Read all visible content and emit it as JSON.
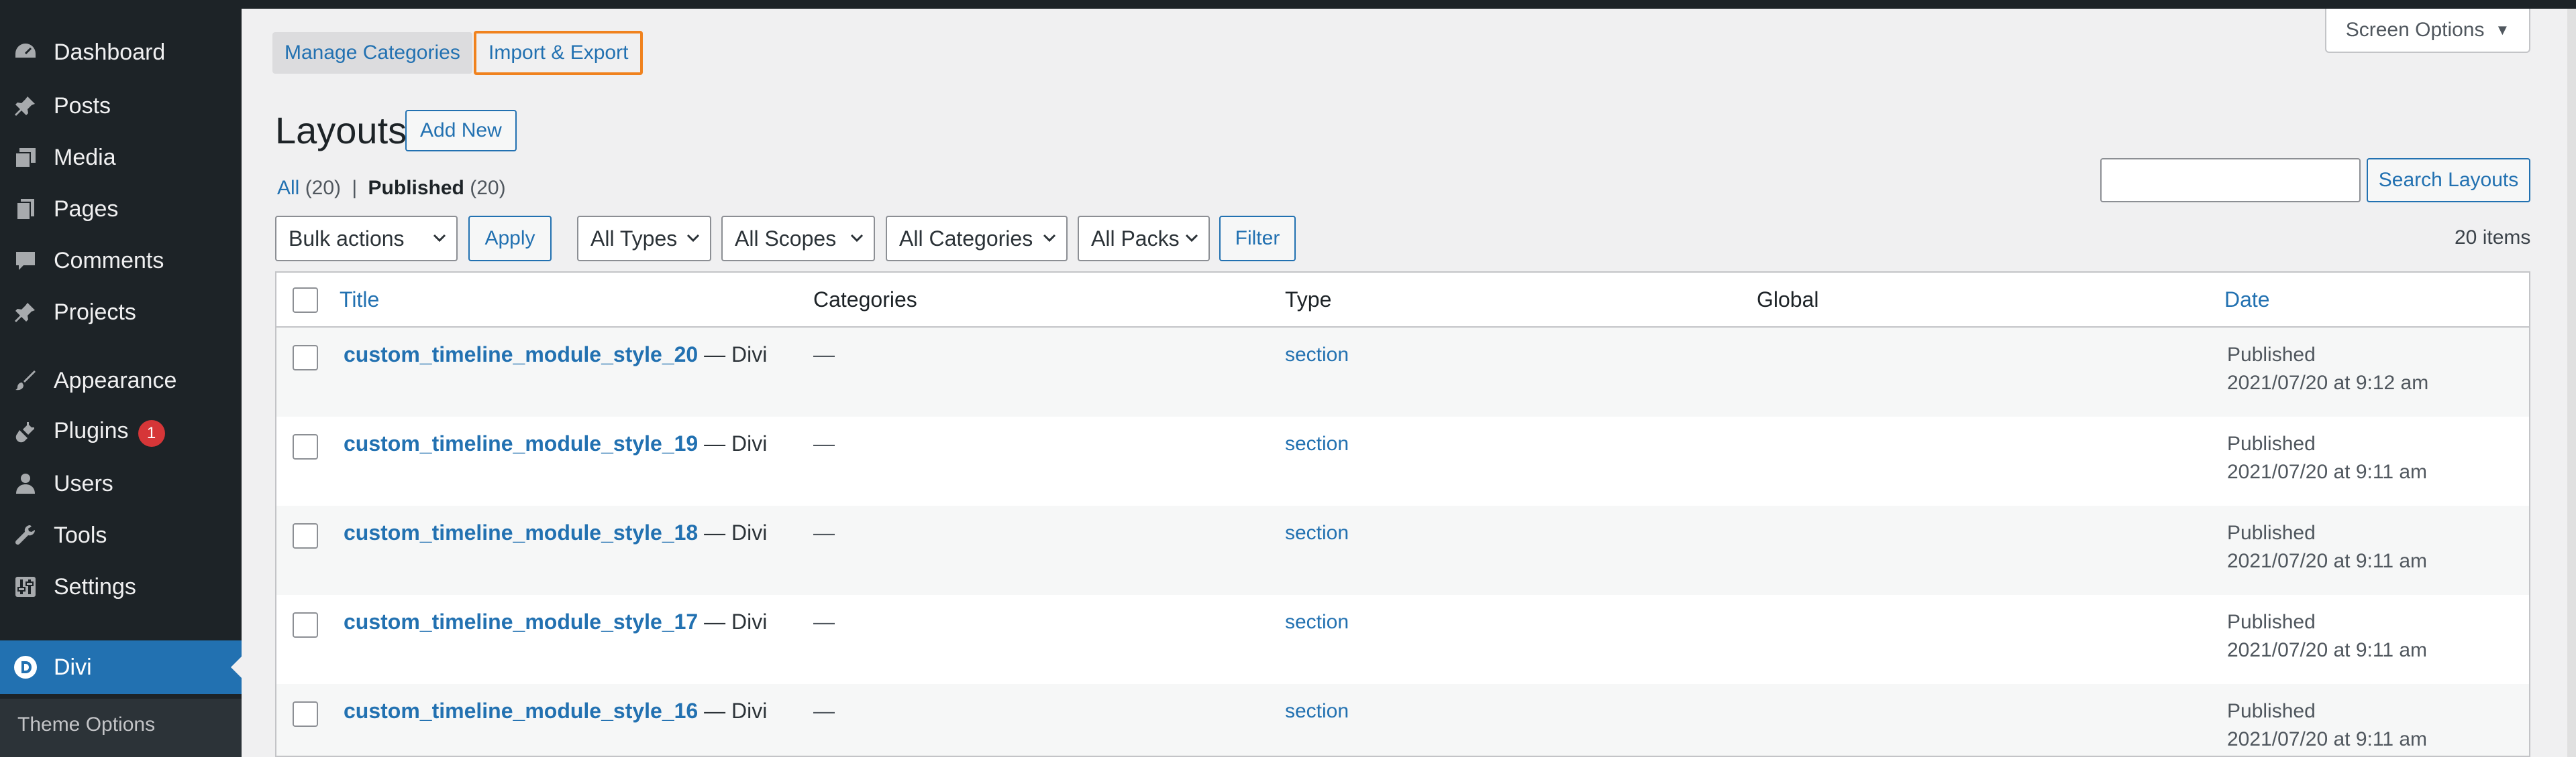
{
  "sidebar": {
    "items": [
      {
        "label": "Dashboard",
        "icon": "dashboard-icon"
      },
      {
        "label": "Posts",
        "icon": "pin-icon"
      },
      {
        "label": "Media",
        "icon": "media-icon"
      },
      {
        "label": "Pages",
        "icon": "pages-icon"
      },
      {
        "label": "Comments",
        "icon": "comment-icon"
      },
      {
        "label": "Projects",
        "icon": "pin-icon"
      },
      {
        "label": "Appearance",
        "icon": "brush-icon"
      },
      {
        "label": "Plugins",
        "icon": "plug-icon",
        "badge": "1"
      },
      {
        "label": "Users",
        "icon": "user-icon"
      },
      {
        "label": "Tools",
        "icon": "wrench-icon"
      },
      {
        "label": "Settings",
        "icon": "settings-icon"
      },
      {
        "label": "Divi",
        "icon": "divi-icon"
      }
    ],
    "submenu_item": "Theme Options"
  },
  "tabs": {
    "manage": "Manage Categories",
    "import_export": "Import & Export"
  },
  "screen_options": "Screen Options",
  "page": {
    "title": "Layouts",
    "add_new": "Add New"
  },
  "filters": {
    "all_label": "All",
    "all_count": "(20)",
    "published_label": "Published",
    "published_count": "(20)",
    "separator": "|"
  },
  "search": {
    "value": "",
    "button": "Search Layouts"
  },
  "toolbar": {
    "bulk": "Bulk actions",
    "apply": "Apply",
    "types": "All Types",
    "scopes": "All Scopes",
    "categories": "All Categories",
    "packs": "All Packs",
    "filter": "Filter",
    "items_count": "20 items"
  },
  "table": {
    "columns": {
      "title": "Title",
      "categories": "Categories",
      "type": "Type",
      "global": "Global",
      "date": "Date"
    },
    "rows": [
      {
        "title": "custom_timeline_module_style_20",
        "suffix": " — Divi",
        "categories": "—",
        "type": "section",
        "status": "Published",
        "date": "2021/07/20 at 9:12 am"
      },
      {
        "title": "custom_timeline_module_style_19",
        "suffix": " — Divi",
        "categories": "—",
        "type": "section",
        "status": "Published",
        "date": "2021/07/20 at 9:11 am"
      },
      {
        "title": "custom_timeline_module_style_18",
        "suffix": " — Divi",
        "categories": "—",
        "type": "section",
        "status": "Published",
        "date": "2021/07/20 at 9:11 am"
      },
      {
        "title": "custom_timeline_module_style_17",
        "suffix": " — Divi",
        "categories": "—",
        "type": "section",
        "status": "Published",
        "date": "2021/07/20 at 9:11 am"
      },
      {
        "title": "custom_timeline_module_style_16",
        "suffix": " — Divi",
        "categories": "—",
        "type": "section",
        "status": "Published",
        "date": "2021/07/20 at 9:11 am"
      }
    ]
  },
  "colors": {
    "accent": "#2271b1",
    "sidebar_bg": "#1d2327",
    "highlight_border": "#f0821e",
    "badge": "#d63638"
  }
}
